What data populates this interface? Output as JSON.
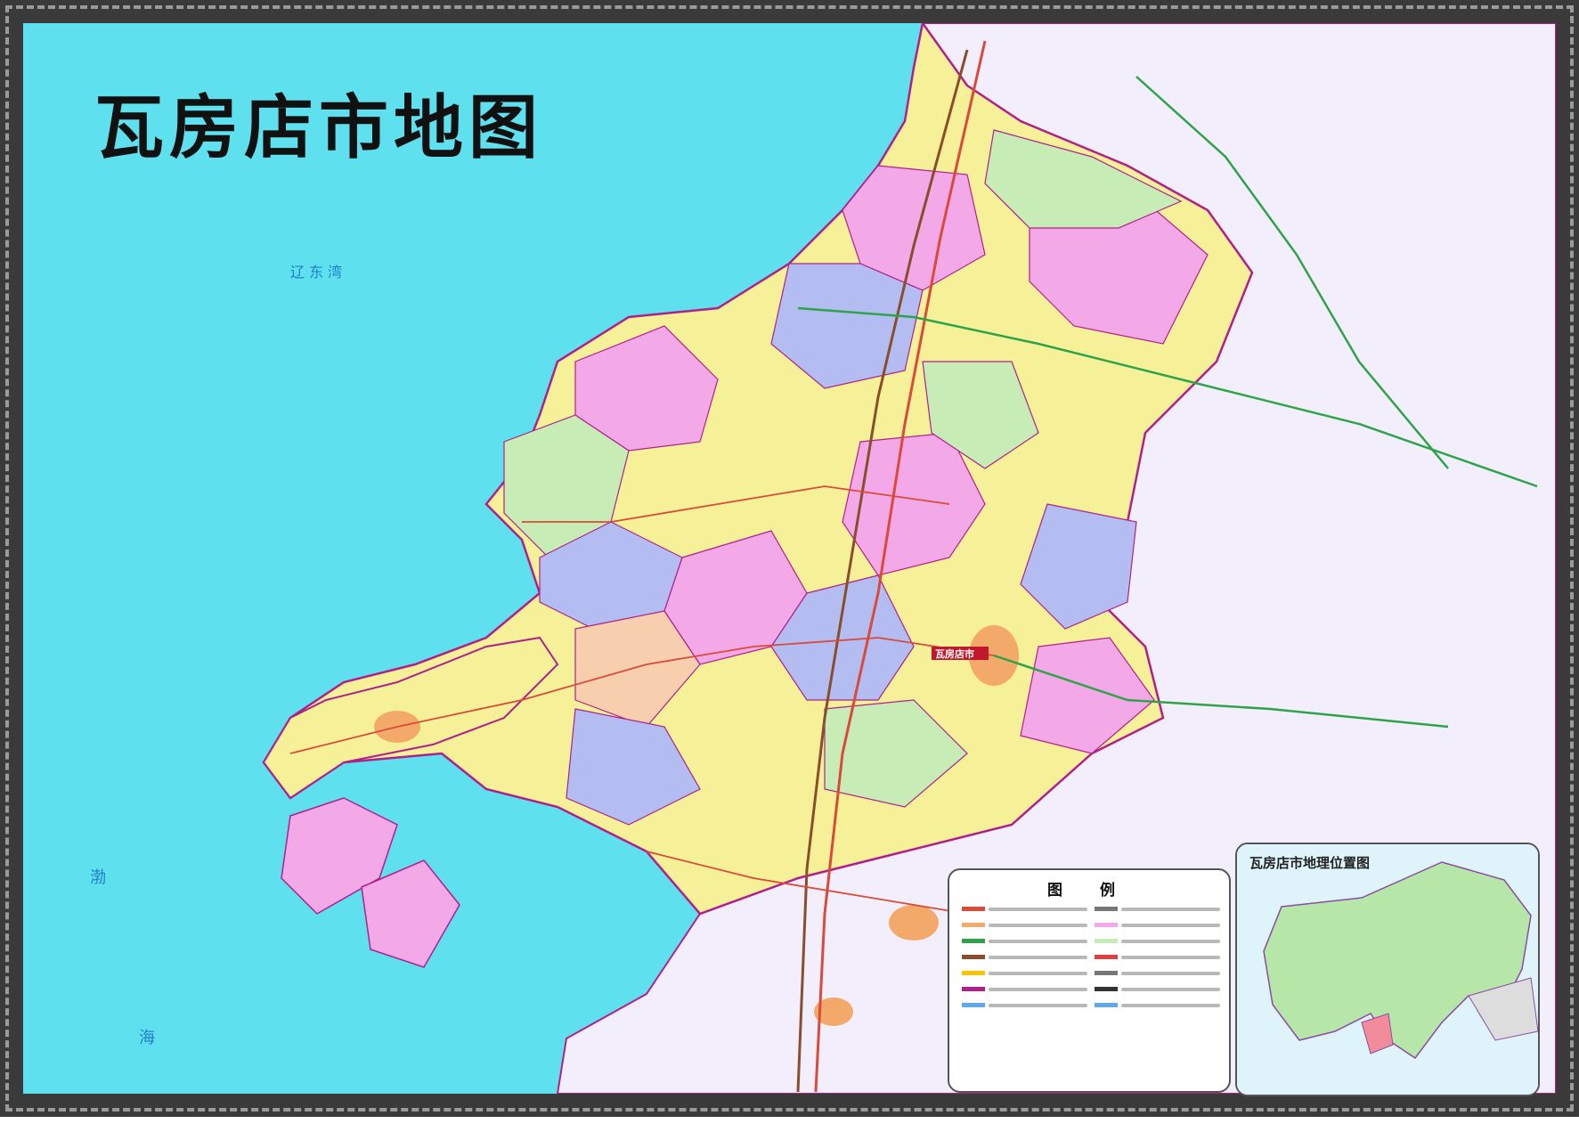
{
  "map": {
    "title": "瓦房店市地图",
    "colors": {
      "sea": "#5fe0ee",
      "land_outside": "#f3eefb",
      "frame": "#3a3a3a",
      "road_highway": "#d94a3a",
      "road_provincial": "#2fa34a",
      "road_rail": "#8a4d2a",
      "boundary": "#b0208a",
      "region_yellow": "#f6f199",
      "region_pink": "#f3a9e8",
      "region_blue": "#b3bdf2",
      "region_green": "#c8ecb6",
      "region_peach": "#f8cfae",
      "urban": "#f3a96a"
    },
    "sea_labels": [
      "辽 东 湾",
      "渤",
      "海"
    ],
    "town_markers": [
      "瓦房店市"
    ]
  },
  "legend": {
    "title": "图 例",
    "symbol_colors": [
      "#d94a3a",
      "#f3a96a",
      "#2fa34a",
      "#8a4d2a",
      "#f6c400",
      "#b0208a",
      "#5fa9e8",
      "#777777",
      "#f3a9e8",
      "#c8ecb6",
      "#e04040",
      "#777777",
      "#333333",
      "#5fa9e8"
    ]
  },
  "inset": {
    "title": "瓦房店市地理位置图",
    "colors": {
      "land": "#b6e7a8",
      "sea": "#dff3fb",
      "highlight": "#f28b9a",
      "boundary": "#8b4aa8"
    }
  }
}
